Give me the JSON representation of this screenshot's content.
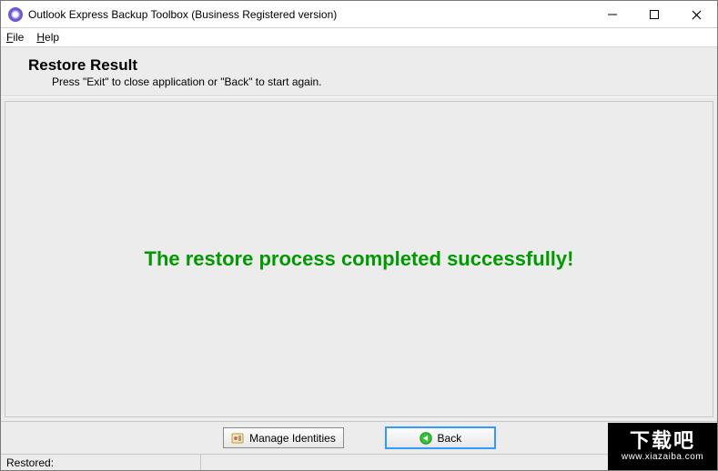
{
  "window": {
    "title": "Outlook Express Backup Toolbox (Business Registered version)"
  },
  "menubar": {
    "file": "File",
    "help": "Help"
  },
  "header": {
    "title": "Restore Result",
    "subtitle": "Press \"Exit\" to close application or \"Back\" to start again."
  },
  "content": {
    "success_message": "The restore process completed successfully!"
  },
  "buttons": {
    "manage_identities": "Manage Identities",
    "back": "Back"
  },
  "statusbar": {
    "restored_label": "Restored:"
  },
  "watermark": {
    "text": "下载吧",
    "url": "www.xiazaiba.com"
  }
}
